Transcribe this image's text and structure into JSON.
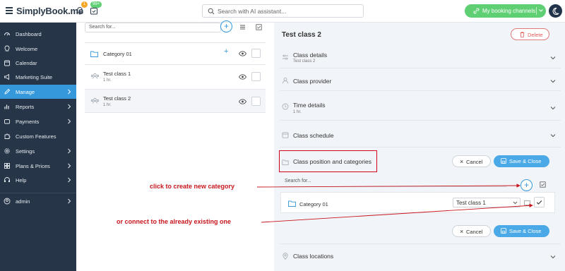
{
  "header": {
    "logo": "SimplyBook.me",
    "notifications_badge": "1",
    "bookings_badge": "99+",
    "search_placeholder": "Search with AI assistant...",
    "channels_label": "My booking channels"
  },
  "sidebar": {
    "items": [
      {
        "label": "Dashboard",
        "icon": "dashboard-icon"
      },
      {
        "label": "Welcome",
        "icon": "lightbulb-icon"
      },
      {
        "label": "Calendar",
        "icon": "calendar-icon"
      },
      {
        "label": "Marketing Suite",
        "icon": "megaphone-icon"
      },
      {
        "label": "Manage",
        "icon": "pencil-icon",
        "active": true
      },
      {
        "label": "Reports",
        "icon": "chart-icon"
      },
      {
        "label": "Payments",
        "icon": "wallet-icon"
      },
      {
        "label": "Custom Features",
        "icon": "puzzle-icon"
      },
      {
        "label": "Settings",
        "icon": "gear-icon"
      },
      {
        "label": "Plans & Prices",
        "icon": "grid-icon"
      },
      {
        "label": "Help",
        "icon": "help-icon"
      }
    ],
    "user": "admin"
  },
  "list": {
    "search_placeholder": "Search for...",
    "category": "Category 01",
    "classes": [
      {
        "name": "Test class 1",
        "duration": "1 hr."
      },
      {
        "name": "Test class 2",
        "duration": "1 hr."
      }
    ]
  },
  "detail": {
    "title": "Test class 2",
    "delete_label": "Delete",
    "sections": {
      "class_details": "Class details",
      "class_details_sub": "Test class 2",
      "class_provider": "Class provider",
      "time_details": "Time details",
      "time_details_sub": "1 hr.",
      "class_schedule": "Class schedule",
      "class_position": "Class position and categories",
      "class_locations": "Class locations"
    },
    "cancel_label": "Cancel",
    "save_label": "Save & Close",
    "inner": {
      "search_placeholder": "Search for...",
      "category": "Category 01",
      "position_value": "Test class 1"
    }
  },
  "annotations": {
    "create": "click to create new category",
    "connect": "or connect to the already existing one"
  },
  "colors": {
    "sidebar_bg": "#263547",
    "accent_blue": "#3498db",
    "brand_green": "#5fcf74",
    "annotation_red": "#c8161d"
  }
}
